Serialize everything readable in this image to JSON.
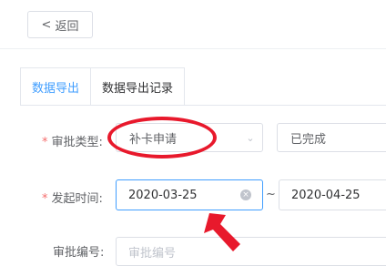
{
  "header": {
    "back_label": "返回",
    "back_icon": "chevron-left-icon"
  },
  "tabs": [
    {
      "label": "数据导出",
      "active": true
    },
    {
      "label": "数据导出记录",
      "active": false
    }
  ],
  "form": {
    "approval_type": {
      "label": "审批类型",
      "value": "补卡申请",
      "required": true
    },
    "status": {
      "value": "已完成"
    },
    "start_time": {
      "label": "发起时间",
      "required": true,
      "from": "2020-03-25",
      "separator": "~",
      "to": "2020-04-25"
    },
    "approval_number": {
      "label": "审批编号",
      "placeholder": "审批编号"
    }
  },
  "colors": {
    "accent": "#409eff",
    "required": "#f56c6c",
    "annotation": "#e8192c"
  }
}
